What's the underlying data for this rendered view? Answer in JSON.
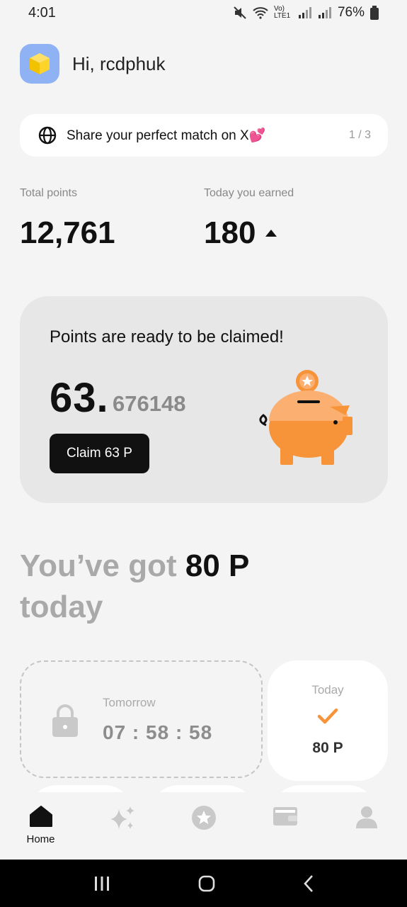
{
  "status_bar": {
    "time": "4:01",
    "network": "Vo) LTE1",
    "battery": "76%"
  },
  "header": {
    "greeting": "Hi, rcdphuk"
  },
  "banner": {
    "text": "Share your perfect match on X💕",
    "page": "1 / 3"
  },
  "stats": {
    "total_label": "Total points",
    "total_value": "12,761",
    "today_label": "Today you earned",
    "today_value": "180"
  },
  "claim": {
    "title": "Points are ready to be claimed!",
    "amount_int": "63.",
    "amount_dec": "676148",
    "button_label": "Claim 63 P"
  },
  "daily": {
    "prefix": "You’ve got",
    "points": "80 P",
    "suffix": "today",
    "tomorrow_label": "Tomorrow",
    "countdown": "07 : 58 : 58",
    "today_label": "Today",
    "today_points": "80 P"
  },
  "nav": {
    "items": [
      {
        "label": "Home",
        "icon": "home-icon",
        "active": true
      },
      {
        "label": "",
        "icon": "sparkles-icon",
        "active": false
      },
      {
        "label": "",
        "icon": "star-circle-icon",
        "active": false
      },
      {
        "label": "",
        "icon": "wallet-icon",
        "active": false
      },
      {
        "label": "",
        "icon": "profile-icon",
        "active": false
      }
    ]
  },
  "colors": {
    "accent": "#f7943a",
    "dark": "#111111",
    "avatar_bg": "#8fb2f5"
  }
}
